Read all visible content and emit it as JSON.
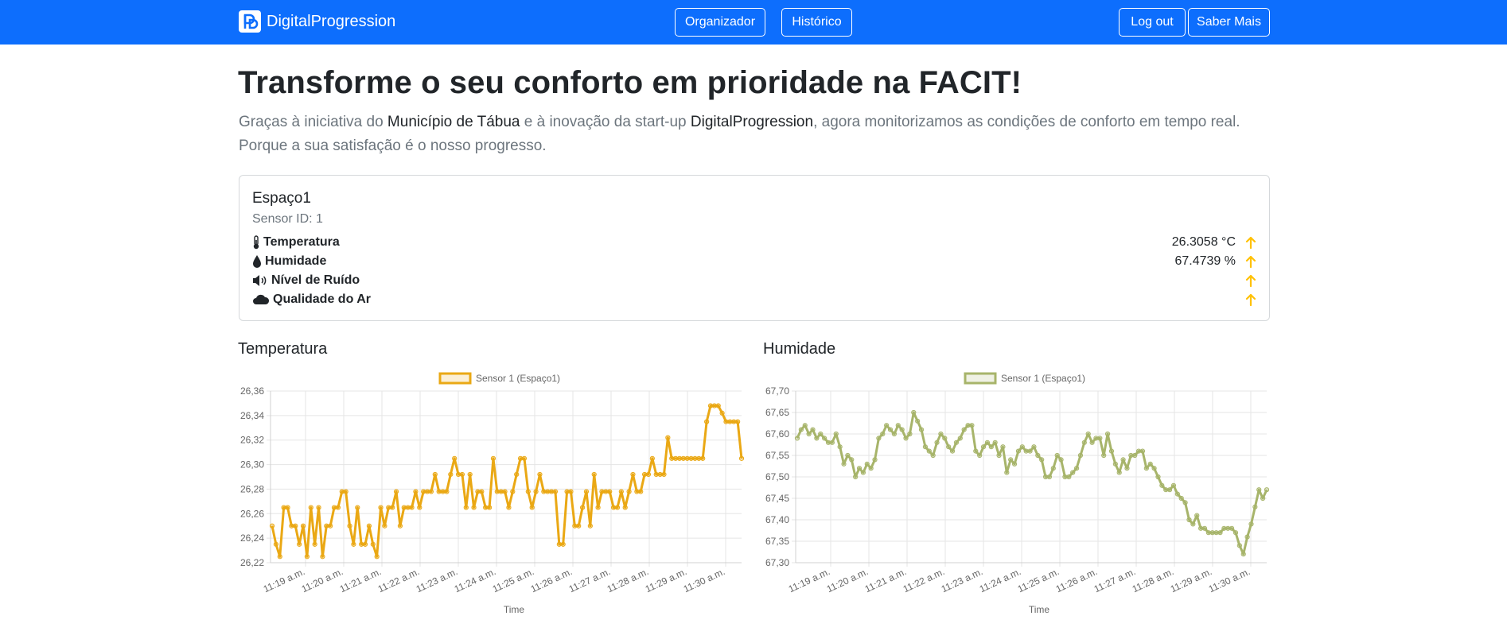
{
  "navbar": {
    "brand": "DigitalProgression",
    "organizer_label": "Organizador",
    "history_label": "Histórico",
    "logout_label": "Log out",
    "more_label": "Saber Mais",
    "color": "#0d6efd"
  },
  "hero": {
    "title": "Transforme o seu conforto em prioridade na FACIT!",
    "lead_part1": "Graças à iniciativa do ",
    "lead_strong1": "Município de Tábua",
    "lead_part2": " e à inovação da start-up ",
    "lead_strong2": "DigitalProgression",
    "lead_part3": ", agora monitorizamos as condições de conforto em tempo real.",
    "lead_line2": "Porque a sua satisfação é o nosso progresso."
  },
  "space_card": {
    "title": "Espaço1",
    "sensor_id": "Sensor ID: 1",
    "metrics": [
      {
        "label": "Temperatura",
        "icon": "thermometer-icon",
        "value": "26.3058 °C",
        "trend": "up"
      },
      {
        "label": "Humidade",
        "icon": "droplet-icon",
        "value": "67.4739 %",
        "trend": "up"
      },
      {
        "label": "Nível de Ruído",
        "icon": "volume-icon",
        "value": "",
        "trend": "up"
      },
      {
        "label": "Qualidade do Ar",
        "icon": "cloud-icon",
        "value": "",
        "trend": "up"
      }
    ],
    "trend_color": "#ffc107"
  },
  "chart_data": [
    {
      "type": "line",
      "title": "Temperatura",
      "xlabel": "Time",
      "ylabel": "",
      "ylim": [
        26.22,
        26.36
      ],
      "yticks": [
        "26,22",
        "26,24",
        "26,26",
        "26,28",
        "26,30",
        "26,32",
        "26,34",
        "26,36"
      ],
      "xticks": [
        "11:19 a.m.",
        "11:20 a.m.",
        "11:21 a.m.",
        "11:22 a.m.",
        "11:23 a.m.",
        "11:24 a.m.",
        "11:25 a.m.",
        "11:26 a.m.",
        "11:27 a.m.",
        "11:28 a.m.",
        "11:29 a.m.",
        "11:30 a.m."
      ],
      "grid": true,
      "legend_position": "top",
      "color": "#eaa814",
      "series": [
        {
          "name": "Sensor 1 (Espaço1)",
          "values": [
            26.25,
            26.235,
            26.225,
            26.265,
            26.265,
            26.25,
            26.25,
            26.235,
            26.25,
            26.225,
            26.265,
            26.235,
            26.265,
            26.225,
            26.25,
            26.25,
            26.265,
            26.265,
            26.278,
            26.278,
            26.25,
            26.235,
            26.265,
            26.235,
            26.235,
            26.25,
            26.235,
            26.225,
            26.265,
            26.25,
            26.265,
            26.265,
            26.278,
            26.25,
            26.265,
            26.265,
            26.265,
            26.278,
            26.265,
            26.278,
            26.278,
            26.278,
            26.292,
            26.278,
            26.278,
            26.278,
            26.292,
            26.305,
            26.292,
            26.292,
            26.265,
            26.292,
            26.265,
            26.278,
            26.278,
            26.265,
            26.265,
            26.305,
            26.278,
            26.278,
            26.278,
            26.265,
            26.278,
            26.292,
            26.305,
            26.305,
            26.278,
            26.265,
            26.278,
            26.292,
            26.278,
            26.278,
            26.278,
            26.278,
            26.235,
            26.235,
            26.278,
            26.278,
            26.25,
            26.25,
            26.265,
            26.278,
            26.25,
            26.292,
            26.265,
            26.278,
            26.278,
            26.278,
            26.265,
            26.265,
            26.278,
            26.265,
            26.278,
            26.292,
            26.278,
            26.278,
            26.292,
            26.292,
            26.305,
            26.292,
            26.292,
            26.292,
            26.322,
            26.305,
            26.305,
            26.305,
            26.305,
            26.305,
            26.305,
            26.305,
            26.305,
            26.305,
            26.335,
            26.348,
            26.348,
            26.348,
            26.342,
            26.335,
            26.335,
            26.335,
            26.335,
            26.305
          ]
        }
      ]
    },
    {
      "type": "line",
      "title": "Humidade",
      "xlabel": "Time",
      "ylabel": "",
      "ylim": [
        67.3,
        67.7
      ],
      "yticks": [
        "67,30",
        "67,35",
        "67,40",
        "67,45",
        "67,50",
        "67,55",
        "67,60",
        "67,65",
        "67,70"
      ],
      "xticks": [
        "11:19 a.m.",
        "11:20 a.m.",
        "11:21 a.m.",
        "11:22 a.m.",
        "11:23 a.m.",
        "11:24 a.m.",
        "11:25 a.m.",
        "11:26 a.m.",
        "11:27 a.m.",
        "11:28 a.m.",
        "11:29 a.m.",
        "11:30 a.m."
      ],
      "grid": true,
      "legend_position": "top",
      "color": "#a7b46a",
      "series": [
        {
          "name": "Sensor 1 (Espaço1)",
          "values": [
            67.59,
            67.61,
            67.62,
            67.6,
            67.61,
            67.59,
            67.6,
            67.59,
            67.58,
            67.58,
            67.6,
            67.57,
            67.53,
            67.55,
            67.54,
            67.5,
            67.52,
            67.51,
            67.53,
            67.52,
            67.54,
            67.59,
            67.6,
            67.62,
            67.61,
            67.6,
            67.62,
            67.61,
            67.59,
            67.6,
            67.65,
            67.63,
            67.61,
            67.57,
            67.56,
            67.55,
            67.58,
            67.6,
            67.59,
            67.57,
            67.56,
            67.58,
            67.59,
            67.61,
            67.62,
            67.62,
            67.56,
            67.55,
            67.57,
            67.58,
            67.57,
            67.58,
            67.55,
            67.57,
            67.51,
            67.54,
            67.53,
            67.56,
            67.57,
            67.56,
            67.56,
            67.57,
            67.55,
            67.54,
            67.5,
            67.5,
            67.52,
            67.55,
            67.54,
            67.5,
            67.5,
            67.51,
            67.52,
            67.55,
            67.58,
            67.6,
            67.58,
            67.59,
            67.59,
            67.55,
            67.6,
            67.56,
            67.53,
            67.51,
            67.54,
            67.52,
            67.55,
            67.55,
            67.56,
            67.56,
            67.52,
            67.53,
            67.52,
            67.5,
            67.48,
            67.47,
            67.47,
            67.48,
            67.46,
            67.45,
            67.44,
            67.4,
            67.39,
            67.41,
            67.38,
            67.38,
            67.37,
            67.37,
            67.37,
            67.37,
            67.38,
            67.38,
            67.38,
            67.37,
            67.34,
            67.32,
            67.36,
            67.39,
            67.43,
            67.47,
            67.45,
            67.47
          ]
        }
      ]
    }
  ]
}
